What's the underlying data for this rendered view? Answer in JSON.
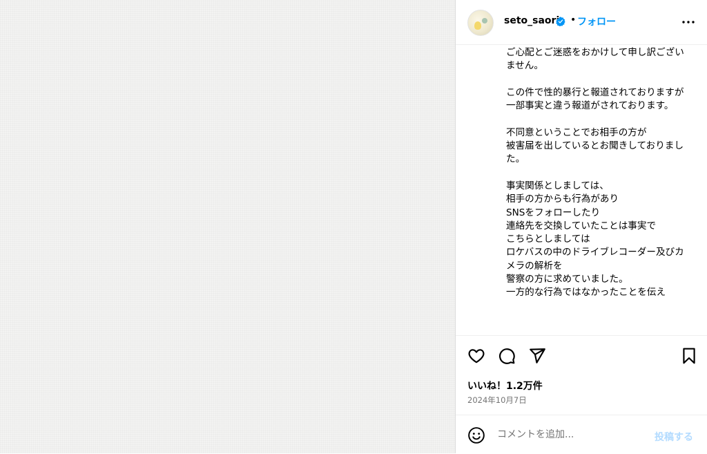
{
  "post": {
    "username": "seto_saori",
    "verified": true,
    "separator": "•",
    "follow_label": "フォロー",
    "caption": "ご心配とご迷惑をおかけして申し訳ございません。\n\nこの件で性的暴行と報道されておりますが\n一部事実と違う報道がされております。\n\n不同意ということでお相手の方が\n被害届を出しているとお聞きしておりました。\n\n事実関係としましては、\n相手の方からも行為があり\nSNSをフォローしたり\n連絡先を交換していたことは事実で\nこちらとしましては\nロケバスの中のドライブレコーダー及びカメラの解析を\n警察の方に求めていました。\n一方的な行為ではなかったことを伝え",
    "likes": "いいね！1.2万件",
    "date": "2024年10月7日"
  },
  "comment": {
    "placeholder": "コメントを追加...",
    "value": "",
    "post_label": "投稿する"
  },
  "icons": {
    "more": "more-horizontal-icon",
    "like": "heart-icon",
    "comment": "comment-bubble-icon",
    "share": "paper-plane-icon",
    "save": "bookmark-icon",
    "emoji": "emoji-smile-icon",
    "verified": "verified-badge-icon"
  },
  "colors": {
    "accent": "#0095f6",
    "post_button_disabled": "#b3dbff",
    "secondary_text": "#737373",
    "divider": "#efefef"
  }
}
